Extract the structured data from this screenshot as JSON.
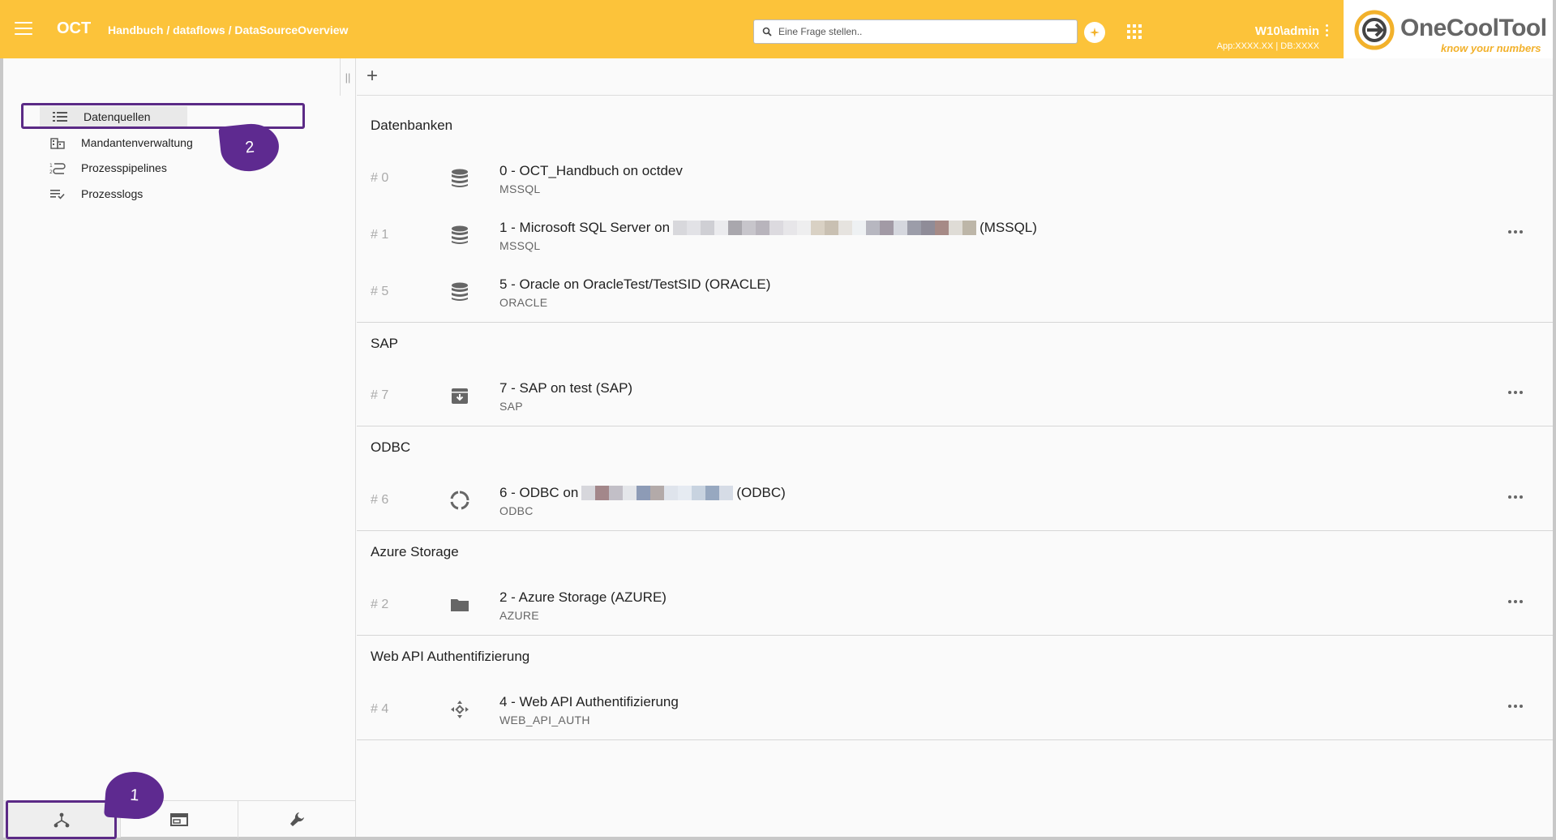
{
  "header": {
    "app_name": "OCT",
    "breadcrumb": "Handbuch / dataflows / DataSourceOverview",
    "search_placeholder": "Eine Frage stellen..",
    "user": "W10\\admin",
    "app_info": "App:XXXX.XX | DB:XXXX",
    "logo_text": "OneCoolTool",
    "logo_tagline": "know your numbers",
    "accent_color": "#fcc33a"
  },
  "sidebar": {
    "items": [
      {
        "label": "Datenquellen",
        "icon": "list-icon"
      },
      {
        "label": "Mandantenverwaltung",
        "icon": "building-icon"
      },
      {
        "label": "Prozesspipelines",
        "icon": "pipeline-icon"
      },
      {
        "label": "Prozesslogs",
        "icon": "log-icon"
      }
    ],
    "bottom_tabs": [
      "dataflow-icon",
      "window-icon",
      "wrench-icon"
    ]
  },
  "callouts": {
    "one": "1",
    "two": "2"
  },
  "groups": [
    {
      "title": "Datenbanken",
      "items": [
        {
          "num": "# 0",
          "title": "0 - OCT_Handbuch on octdev",
          "sub": "MSSQL",
          "icon": "database-icon"
        },
        {
          "num": "# 1",
          "title_pre": "1 - Microsoft SQL Server on",
          "title_post": "(MSSQL)",
          "sub": "MSSQL",
          "icon": "database-icon"
        },
        {
          "num": "# 5",
          "title": "5 - Oracle on OracleTest/TestSID (ORACLE)",
          "sub": "ORACLE",
          "icon": "database-icon"
        }
      ]
    },
    {
      "title": "SAP",
      "items": [
        {
          "num": "# 7",
          "title": "7 - SAP on test (SAP)",
          "sub": "SAP",
          "icon": "archive-icon"
        }
      ]
    },
    {
      "title": "ODBC",
      "items": [
        {
          "num": "# 6",
          "title_pre": "6 - ODBC on",
          "title_post": "(ODBC)",
          "sub": "ODBC",
          "icon": "odbc-icon"
        }
      ]
    },
    {
      "title": "Azure Storage",
      "items": [
        {
          "num": "# 2",
          "title": "2 - Azure Storage (AZURE)",
          "sub": "AZURE",
          "icon": "folder-icon"
        }
      ]
    },
    {
      "title": "Web API Authentifizierung",
      "items": [
        {
          "num": "# 4",
          "title": "4 - Web API Authentifizierung",
          "sub": "WEB_API_AUTH",
          "icon": "api-icon"
        }
      ]
    }
  ]
}
